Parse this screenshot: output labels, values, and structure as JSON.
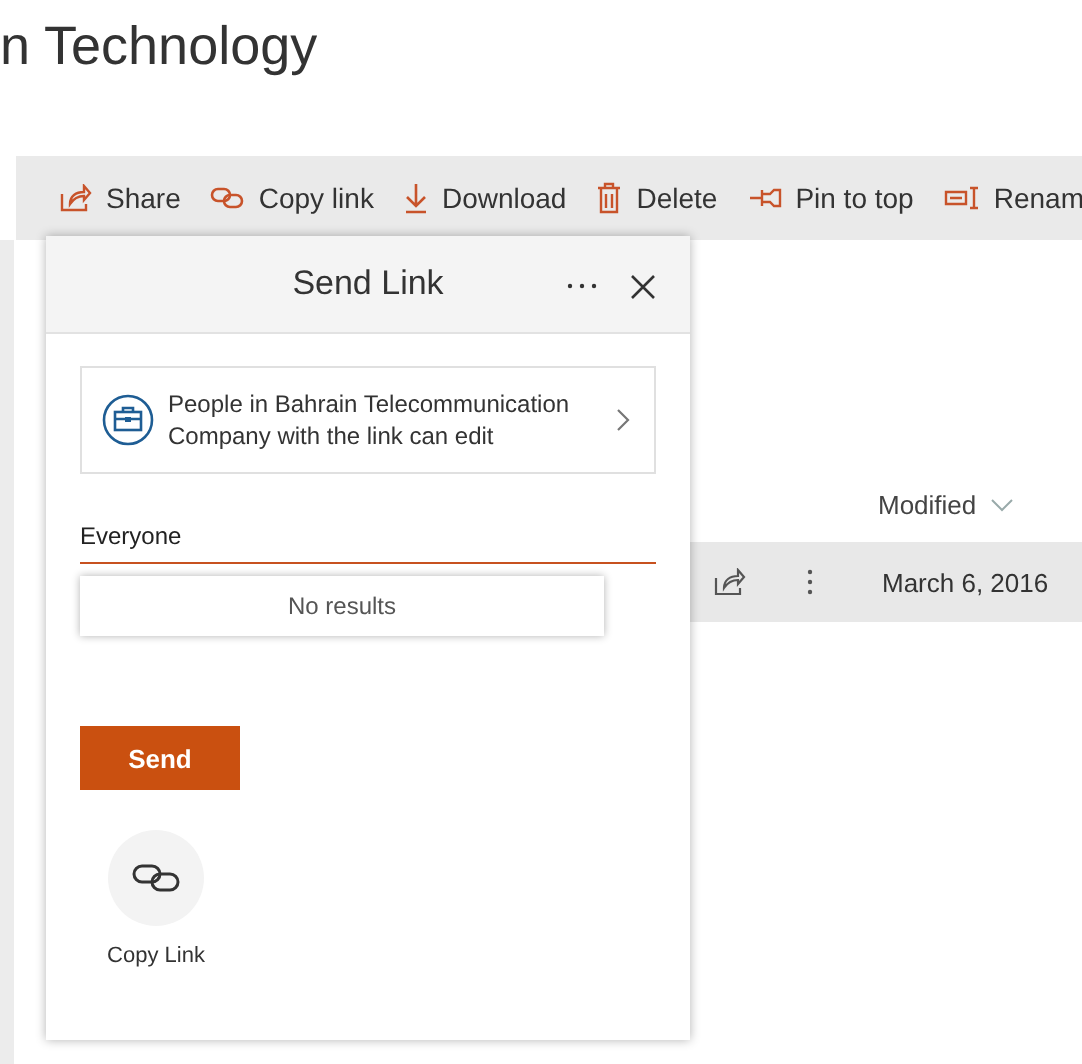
{
  "page": {
    "title": "n Technology"
  },
  "toolbar": [
    {
      "kind": "share",
      "label": "Share"
    },
    {
      "kind": "link",
      "label": "Copy link"
    },
    {
      "kind": "download",
      "label": "Download"
    },
    {
      "kind": "delete",
      "label": "Delete"
    },
    {
      "kind": "pin",
      "label": "Pin to top"
    },
    {
      "kind": "rename",
      "label": "Renam"
    }
  ],
  "list": {
    "columns": [
      {
        "label": "Modified"
      }
    ],
    "rows": [
      {
        "selected": true,
        "modified": "March 6, 2016"
      }
    ]
  },
  "dialog": {
    "title": "Send Link",
    "permission": "People in Bahrain Telecommunication Company with the link can edit",
    "recipient": "Everyone",
    "suggestion": "No results",
    "send": "Send",
    "copy_link": "Copy Link"
  }
}
